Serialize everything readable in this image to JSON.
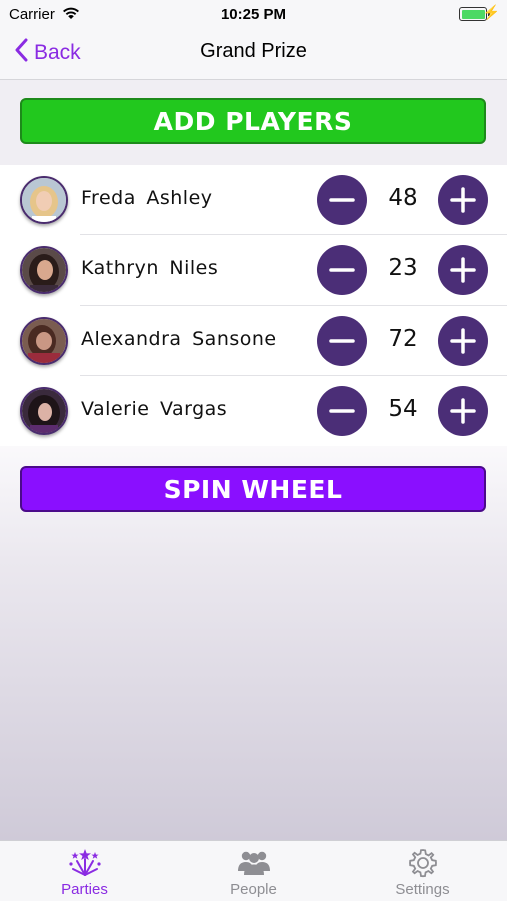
{
  "status_bar": {
    "carrier": "Carrier",
    "time": "10:25 PM"
  },
  "nav": {
    "back_label": "Back",
    "title": "Grand Prize"
  },
  "actions": {
    "add_players": "ADD PLAYERS",
    "spin_wheel": "SPIN WHEEL"
  },
  "players": [
    {
      "name": "Freda  Ashley",
      "score": "48"
    },
    {
      "name": "Kathryn  Niles",
      "score": "23"
    },
    {
      "name": "Alexandra  Sansone",
      "score": "72"
    },
    {
      "name": "Valerie  Vargas",
      "score": "54"
    }
  ],
  "tabs": [
    {
      "label": "Parties",
      "icon": "party-icon",
      "active": true
    },
    {
      "label": "People",
      "icon": "people-icon",
      "active": false
    },
    {
      "label": "Settings",
      "icon": "gear-icon",
      "active": false
    }
  ],
  "colors": {
    "accent": "#8a2be2",
    "add_button": "#22c81e",
    "spin_button": "#8a0fff",
    "counter_button": "#4b2e77"
  }
}
